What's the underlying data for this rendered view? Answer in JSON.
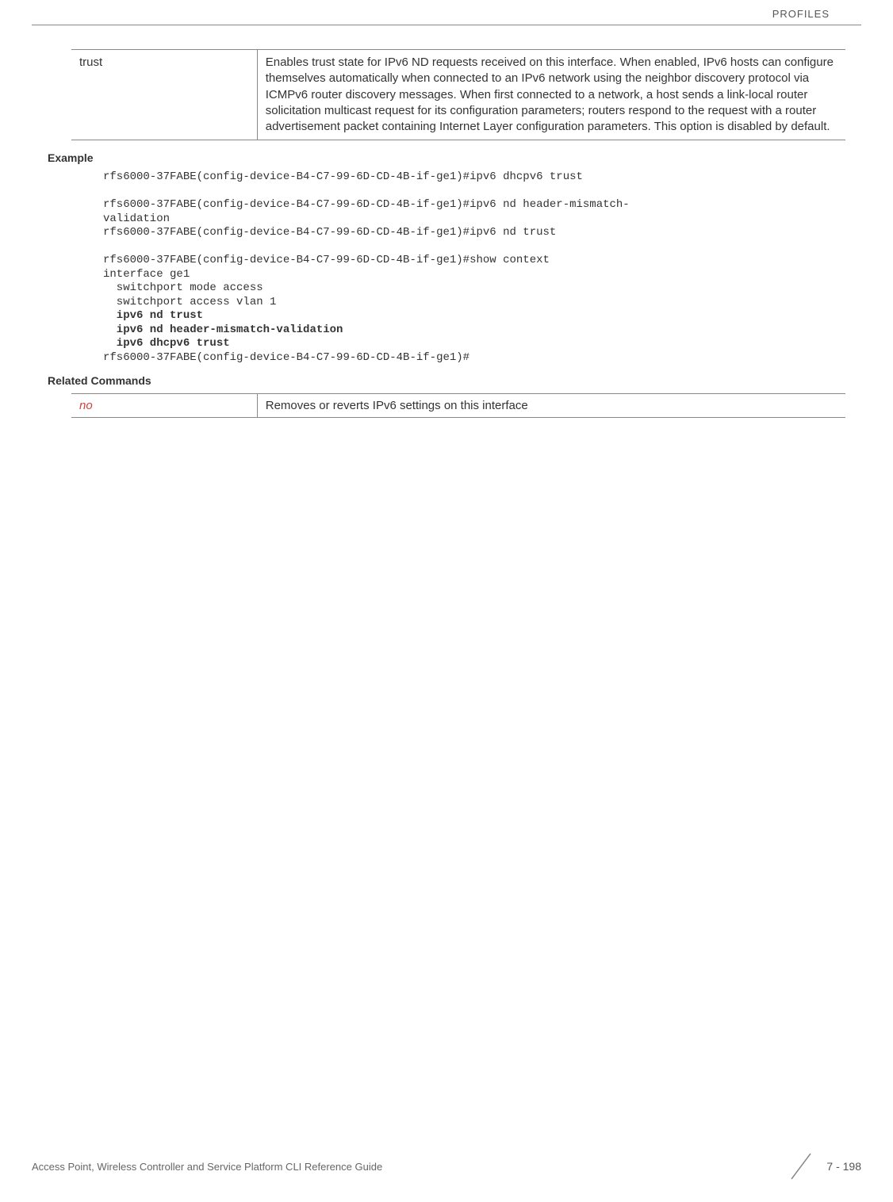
{
  "header": {
    "section": "PROFILES"
  },
  "paramTable": {
    "row": {
      "name": "trust",
      "description": "Enables trust state for IPv6 ND requests received on this interface. When enabled, IPv6 hosts can configure themselves automatically when connected to an IPv6 network using the neighbor discovery protocol via ICMPv6 router discovery messages. When first connected to a network, a host sends a link-local router solicitation multicast request for its configuration parameters; routers respond to the request with a router advertisement packet containing Internet Layer configuration parameters. This option is disabled by default."
    }
  },
  "sections": {
    "example": "Example",
    "related": "Related Commands"
  },
  "cli": {
    "line1": "rfs6000-37FABE(config-device-B4-C7-99-6D-CD-4B-if-ge1)#ipv6 dhcpv6 trust",
    "line2": "rfs6000-37FABE(config-device-B4-C7-99-6D-CD-4B-if-ge1)#ipv6 nd header-mismatch-",
    "line3": "validation",
    "line4": "rfs6000-37FABE(config-device-B4-C7-99-6D-CD-4B-if-ge1)#ipv6 nd trust",
    "line5": "rfs6000-37FABE(config-device-B4-C7-99-6D-CD-4B-if-ge1)#show context",
    "line6": "interface ge1",
    "line7": "  switchport mode access",
    "line8": "  switchport access vlan 1",
    "bold1": "  ipv6 nd trust",
    "bold2": "  ipv6 nd header-mismatch-validation",
    "bold3": "  ipv6 dhcpv6 trust",
    "line9": "rfs6000-37FABE(config-device-B4-C7-99-6D-CD-4B-if-ge1)#"
  },
  "relatedTable": {
    "row": {
      "cmd": "no",
      "desc": "Removes or reverts IPv6 settings on this interface"
    }
  },
  "footer": {
    "text": "Access Point, Wireless Controller and Service Platform CLI Reference Guide",
    "page": "7 - 198"
  }
}
